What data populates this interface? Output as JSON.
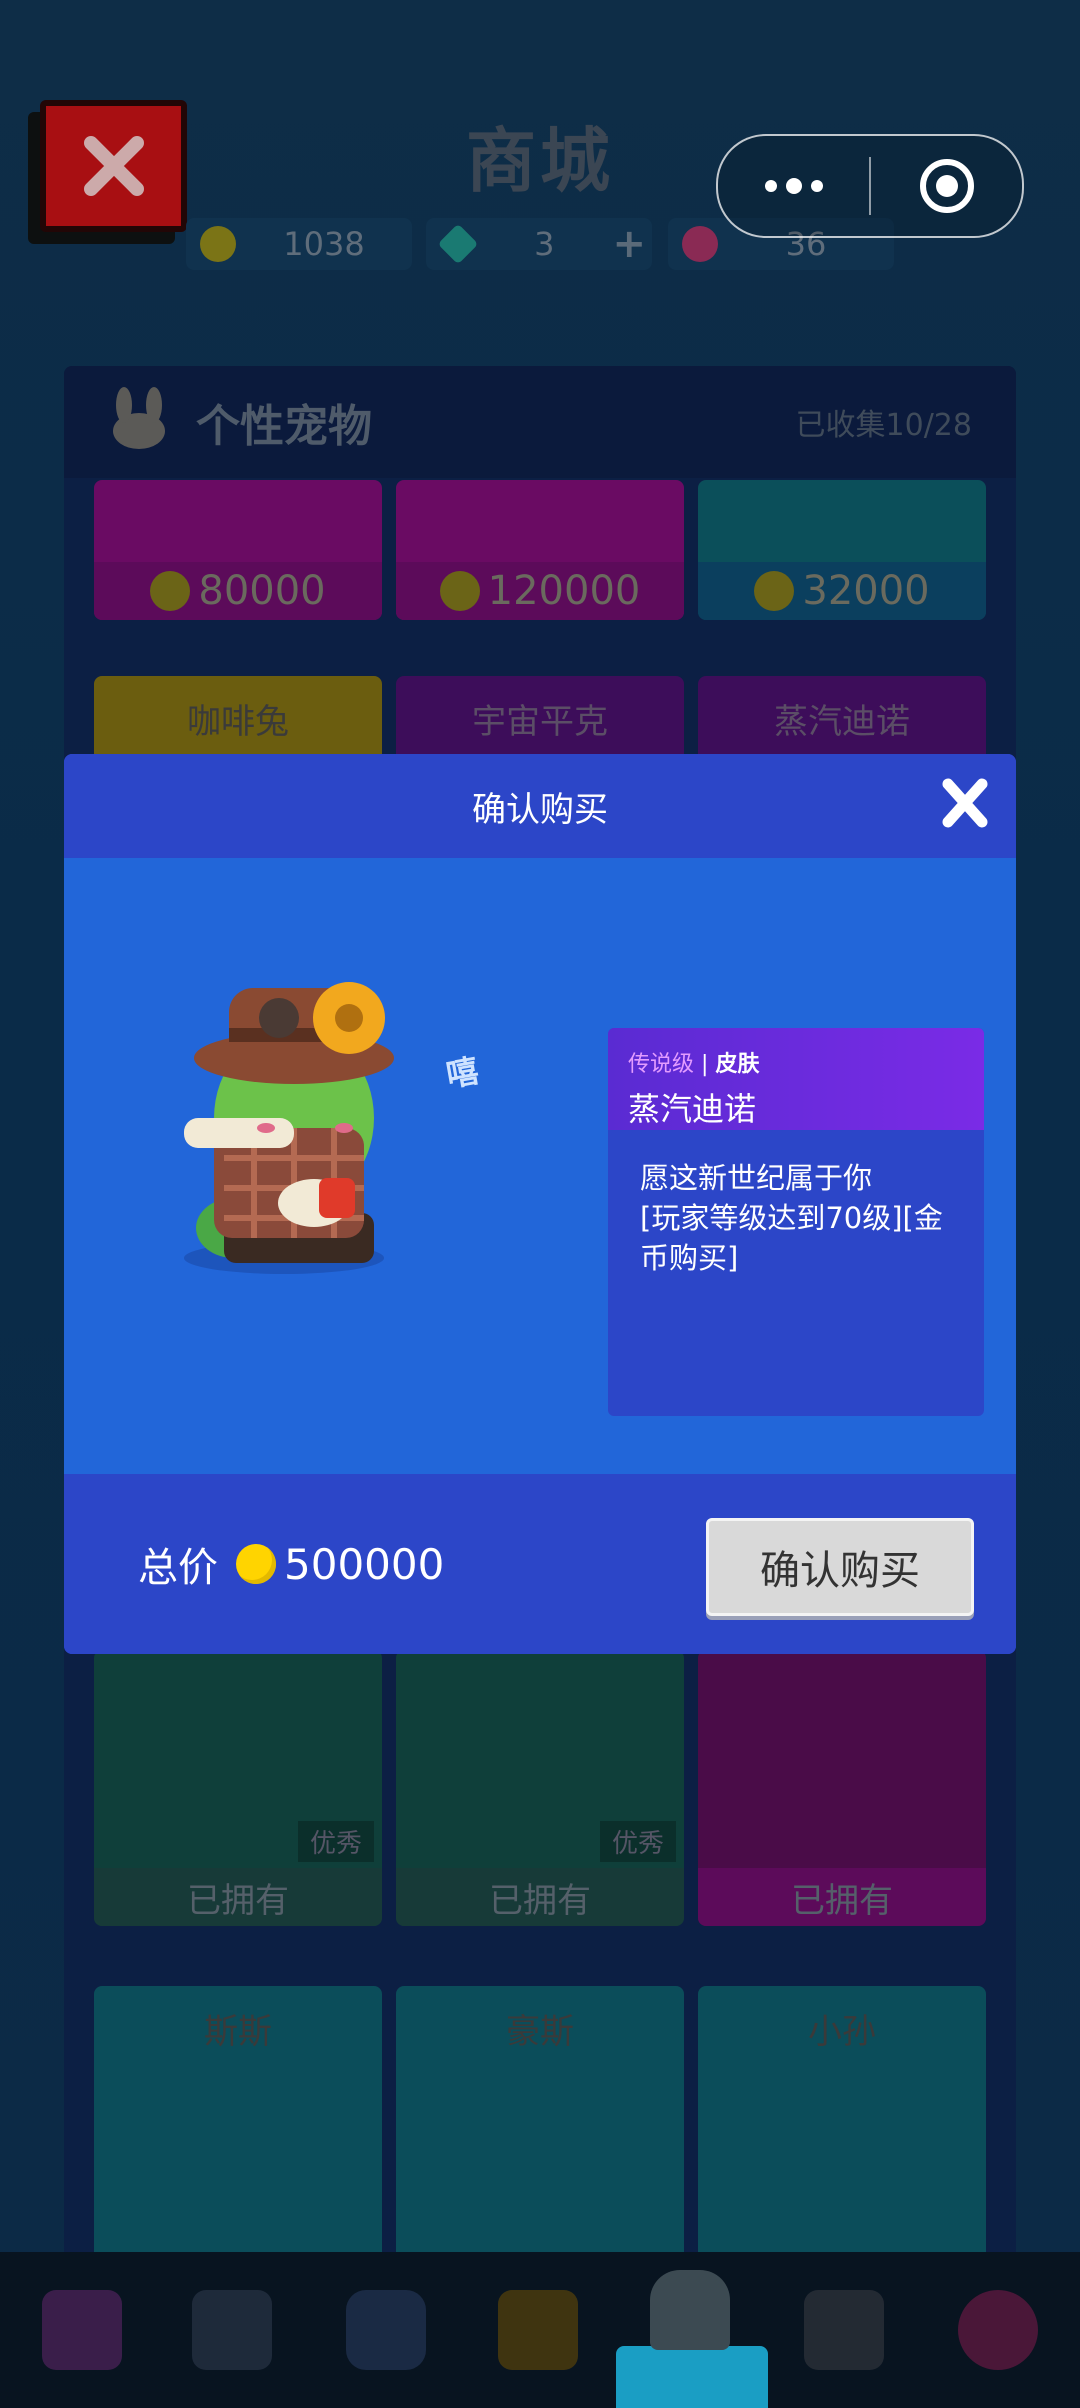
{
  "shop": {
    "title": "商城",
    "currencies": [
      {
        "name": "coin",
        "value": "1038",
        "color": "#7b7416"
      },
      {
        "name": "diamond",
        "value": "3",
        "color": "#1a7a72",
        "plus": "+"
      },
      {
        "name": "lotus",
        "value": "36",
        "color": "#8a2a54"
      }
    ],
    "section": {
      "title": "个性宠物",
      "collected": "已收集10/28"
    },
    "row1_prices": [
      "80000",
      "120000",
      "32000"
    ],
    "row2_names": [
      "咖啡兔",
      "宇宙平克",
      "蒸汽迪诺"
    ],
    "row3": [
      {
        "tag": "优秀",
        "status": "已拥有"
      },
      {
        "tag": "优秀",
        "status": "已拥有"
      },
      {
        "tag": "",
        "status": "已拥有"
      }
    ],
    "row4_names": [
      "斯斯",
      "豪斯",
      "小孙"
    ]
  },
  "modal": {
    "title": "确认购买",
    "rarity": "传说级",
    "rarity_sep": "|",
    "kind": "皮肤",
    "item_name": "蒸汽迪诺",
    "description": "愿这新世纪属于你\n[玩家等级达到70级][金币购买]",
    "onomatopoeia": "嘻",
    "total_label": "总价",
    "total_value": "500000",
    "confirm_label": "确认购买"
  },
  "colors": {
    "modal_blue": "#2266d9",
    "modal_header": "#2c46c8",
    "legend_purple": "#6b2ee0",
    "coin_yellow": "#ffd400"
  },
  "nav_icons": [
    "chest-icon",
    "star-chat-icon",
    "robot-tv-icon",
    "face-icon",
    "bunny-icon",
    "joystick-icon",
    "lotus-icon"
  ]
}
